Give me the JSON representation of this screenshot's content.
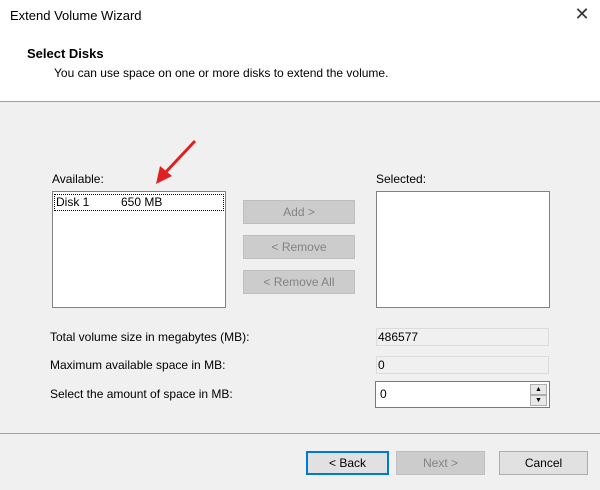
{
  "window": {
    "title": "Extend Volume Wizard",
    "close_icon": "close-icon"
  },
  "header": {
    "title": "Select Disks",
    "subtitle": "You can use space on one or more disks to extend the volume."
  },
  "available": {
    "label": "Available:",
    "items": [
      {
        "name": "Disk 1",
        "size": "650 MB"
      }
    ]
  },
  "selected": {
    "label": "Selected:",
    "items": []
  },
  "buttons": {
    "add": "Add >",
    "remove": "< Remove",
    "remove_all": "< Remove All",
    "back": "< Back",
    "next": "Next >",
    "cancel": "Cancel"
  },
  "fields": {
    "total_label": "Total volume size in megabytes (MB):",
    "total_value": "486577",
    "max_label": "Maximum available space in MB:",
    "max_value": "0",
    "amount_label": "Select the amount of space in MB:",
    "amount_value": "0"
  },
  "colors": {
    "accent": "#0078d7",
    "annotation_arrow": "#e02020"
  }
}
